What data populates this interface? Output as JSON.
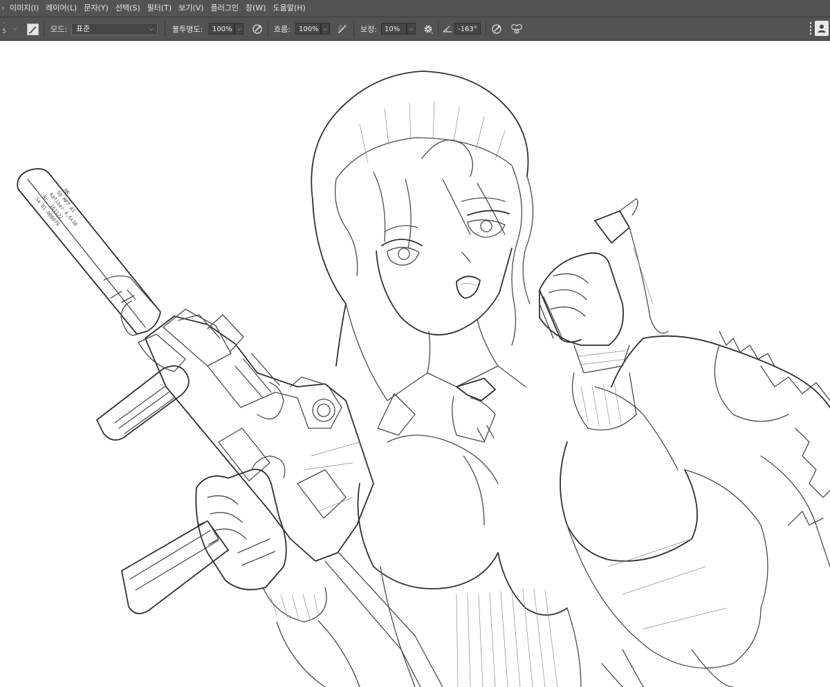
{
  "menu": {
    "items": [
      "이미지(I)",
      "레이어(L)",
      "문자(Y)",
      "선택(S)",
      "필터(T)",
      "보기(V)",
      "플러그인",
      "창(W)",
      "도움말(H)"
    ]
  },
  "options": {
    "brush_size": "5",
    "mode_label": "모드:",
    "mode_value": "표준",
    "opacity_label": "불투명도:",
    "opacity_value": "100%",
    "flow_label": "흐름:",
    "flow_value": "100%",
    "smoothing_label": "보정:",
    "smoothing_value": "10%",
    "angle_value": "-163°"
  },
  "icons": {
    "brush_panel": "brush-settings-icon",
    "opacity_pressure": "pressure-opacity-icon",
    "airbrush": "airbrush-icon",
    "smoothing_settings": "gear-icon",
    "angle": "angle-icon",
    "size_pressure": "pressure-size-icon",
    "symmetry": "butterfly-symmetry-icon",
    "panel_grip": "panel-grip-icon",
    "share": "user-icon"
  },
  "canvas": {
    "engraving": [
      "HK",
      "SD MP7 A1",
      "Kaliber 4,6x30",
      "Nr. 161122",
      "Sa 01-008079"
    ]
  },
  "colors": {
    "chrome": "#535353",
    "field": "#454545",
    "text": "#e4e4e4",
    "canvas": "#ffffff",
    "line": "#4a4a4a"
  }
}
